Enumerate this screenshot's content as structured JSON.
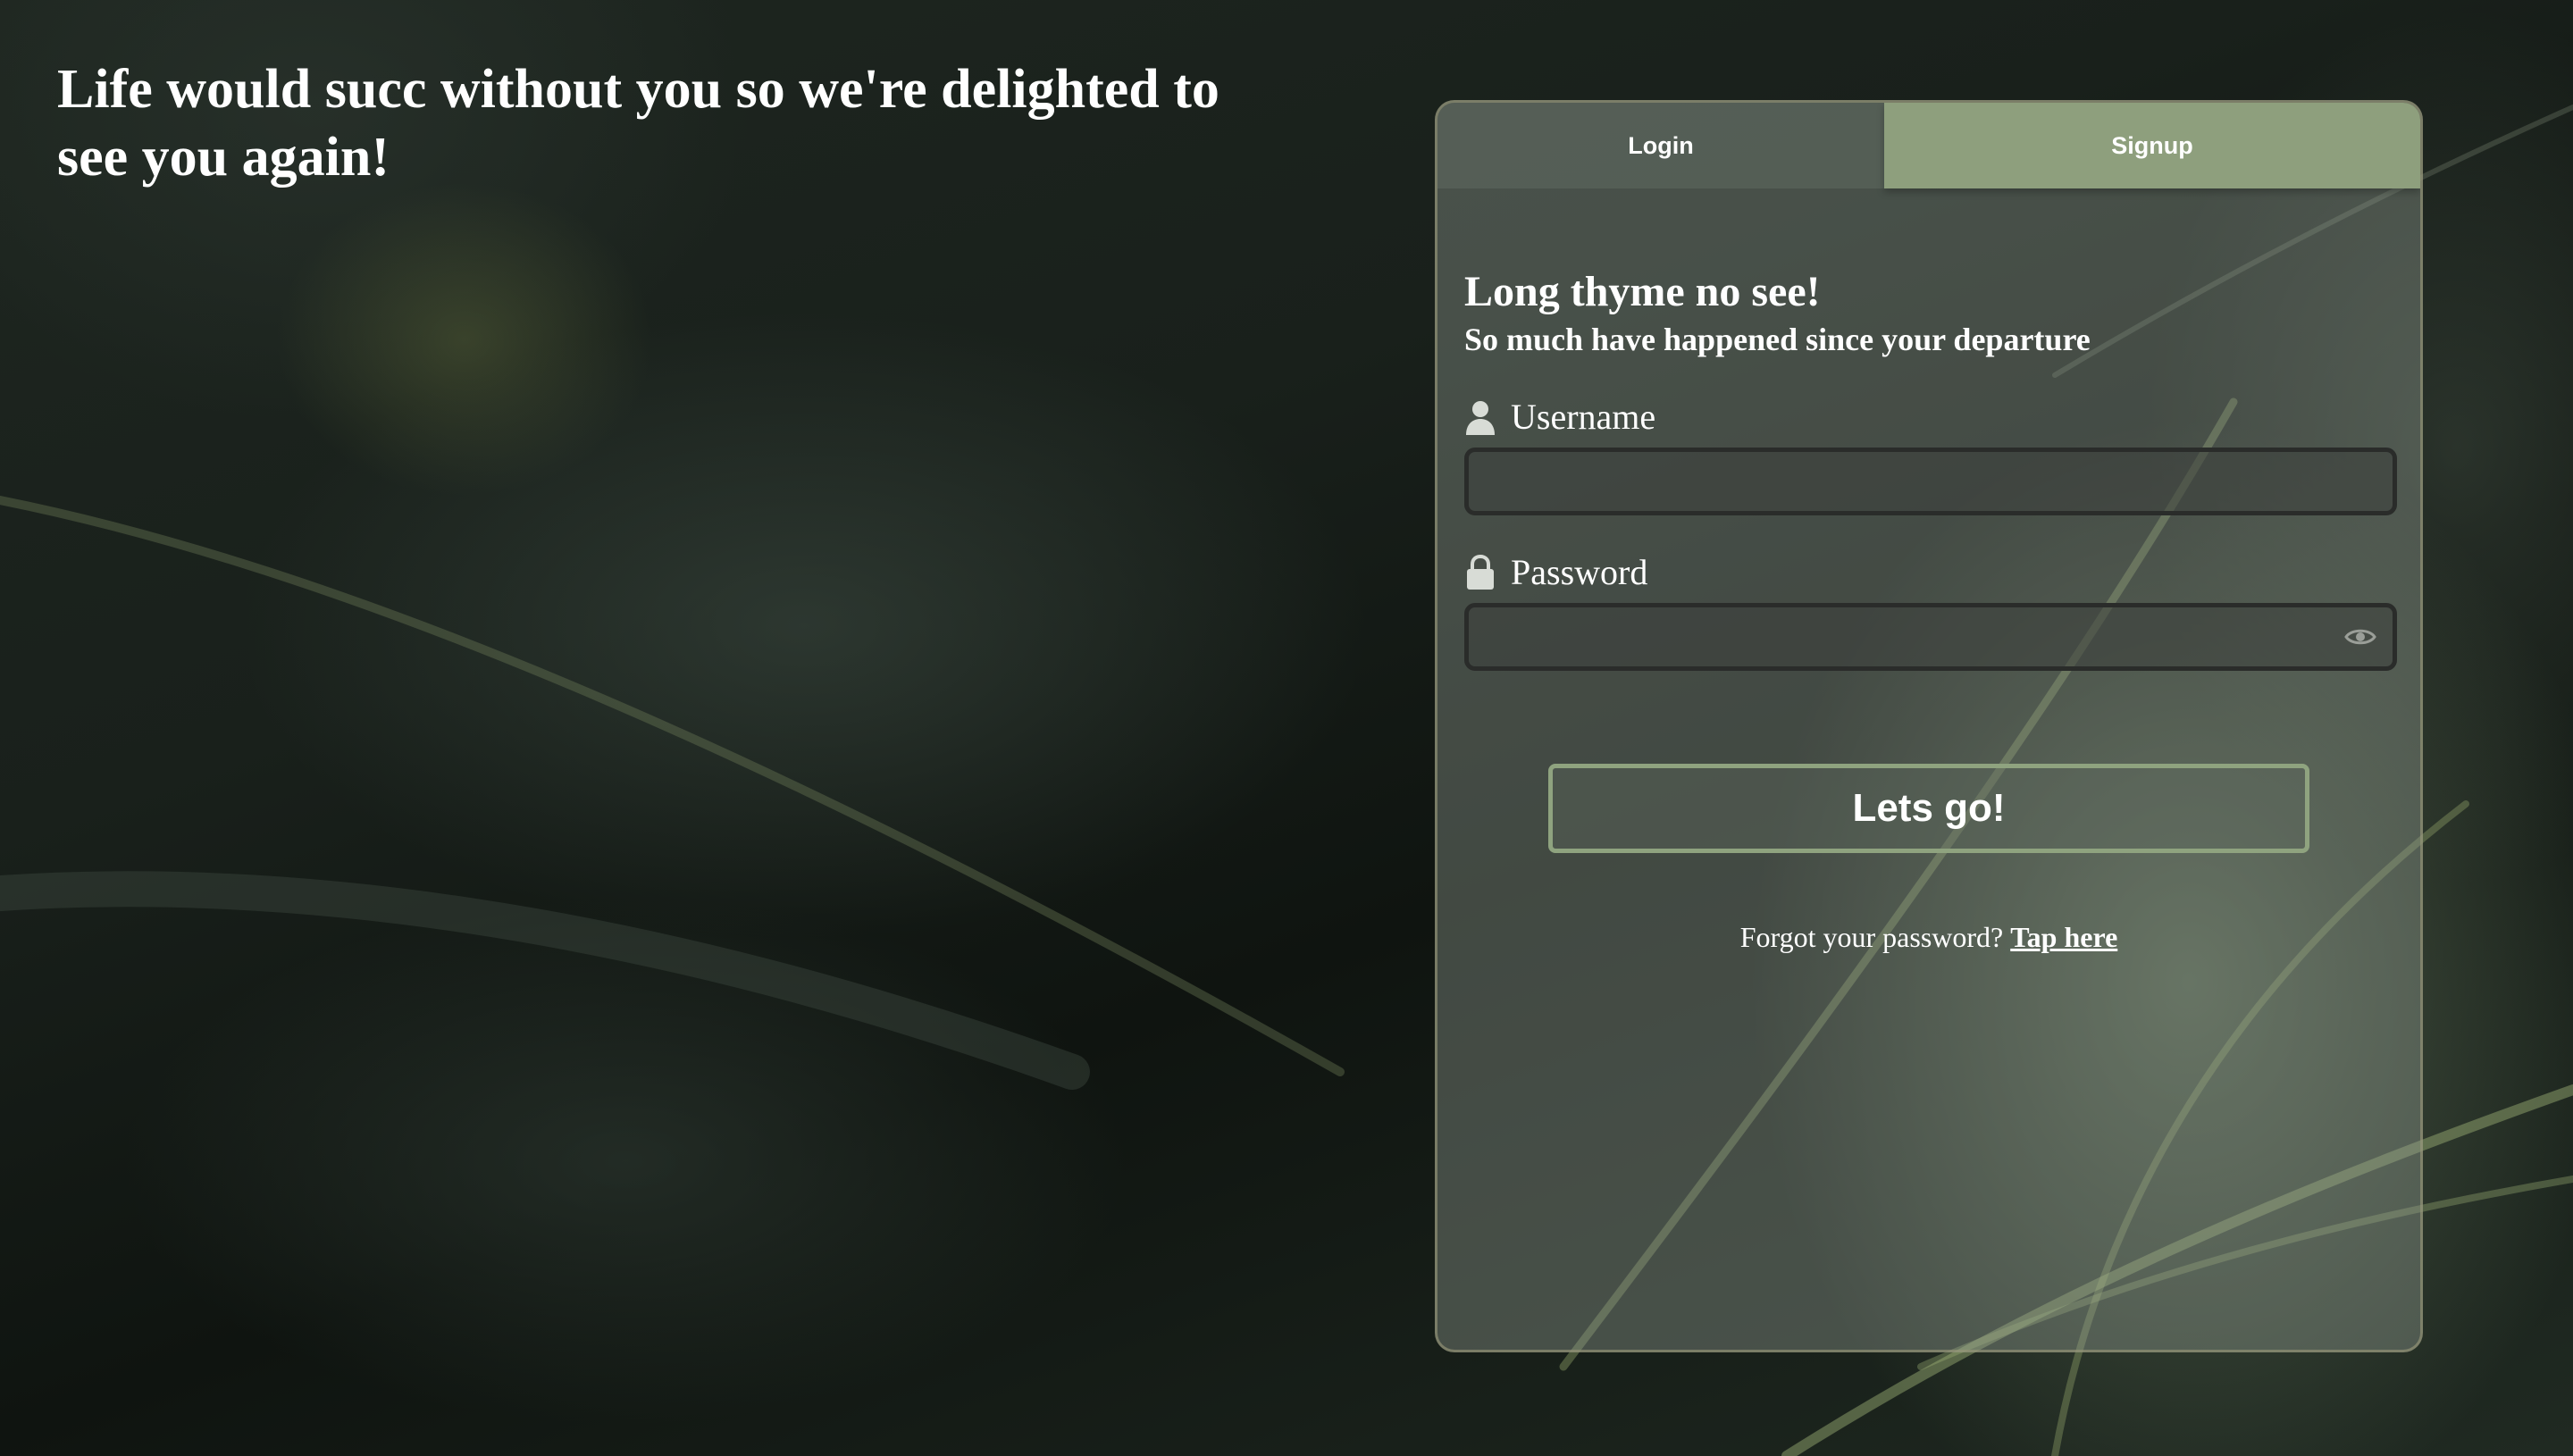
{
  "headline": "Life would succ without you so we're delighted to see you again!",
  "tabs": [
    {
      "label": "Login",
      "active": true
    },
    {
      "label": "Signup",
      "active": false
    }
  ],
  "form": {
    "title": "Long thyme no see!",
    "subtitle": "So much have happened since your departure",
    "username": {
      "label": "Username",
      "value": "",
      "placeholder": ""
    },
    "password": {
      "label": "Password",
      "value": "",
      "placeholder": ""
    },
    "submit_label": "Lets go!",
    "forgot_text": "Forgot your password?",
    "forgot_link": "Tap here"
  },
  "icons": {
    "username": "user-icon",
    "password": "lock-icon",
    "toggle": "eye-icon"
  },
  "colors": {
    "accent": "#8e9f7d",
    "text": "#ffffff",
    "input_border": "#2a2c2a"
  }
}
